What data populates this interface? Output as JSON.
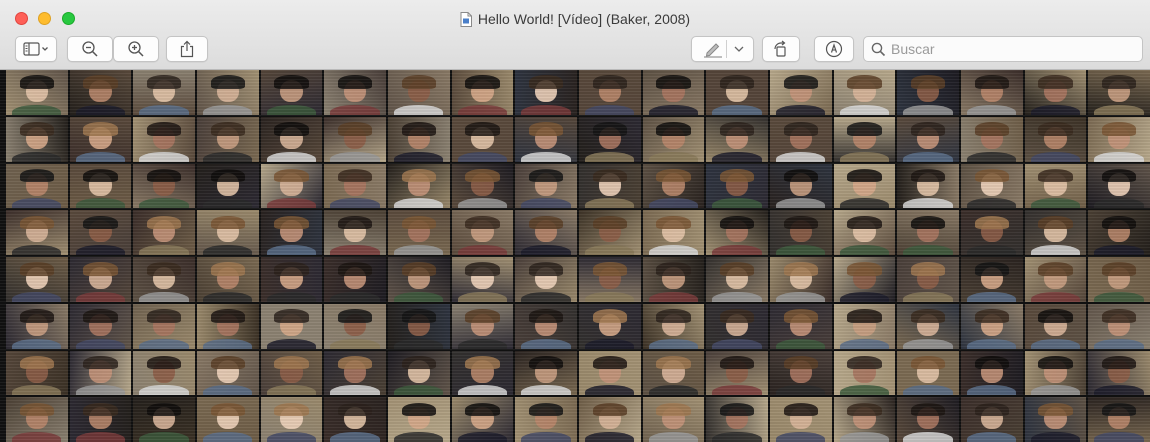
{
  "window": {
    "title": "Hello World! [Vídeo] (Baker, 2008)",
    "doc_icon": "document-icon"
  },
  "toolbar": {
    "sidebar_button_icon": "sidebar-icon",
    "zoom_out_icon": "zoom-out-icon",
    "zoom_in_icon": "zoom-in-icon",
    "share_icon": "share-icon",
    "markup_pen_icon": "pen-icon",
    "rotate_icon": "rotate-icon",
    "markup_icon": "markup-icon"
  },
  "search": {
    "placeholder": "Buscar",
    "value": ""
  },
  "content": {
    "description_icon": "video-mosaic",
    "rows": 8,
    "columns": 18
  },
  "colors": {
    "close": "#fe5f57",
    "minimize": "#febc2e",
    "maximize": "#28c840"
  }
}
